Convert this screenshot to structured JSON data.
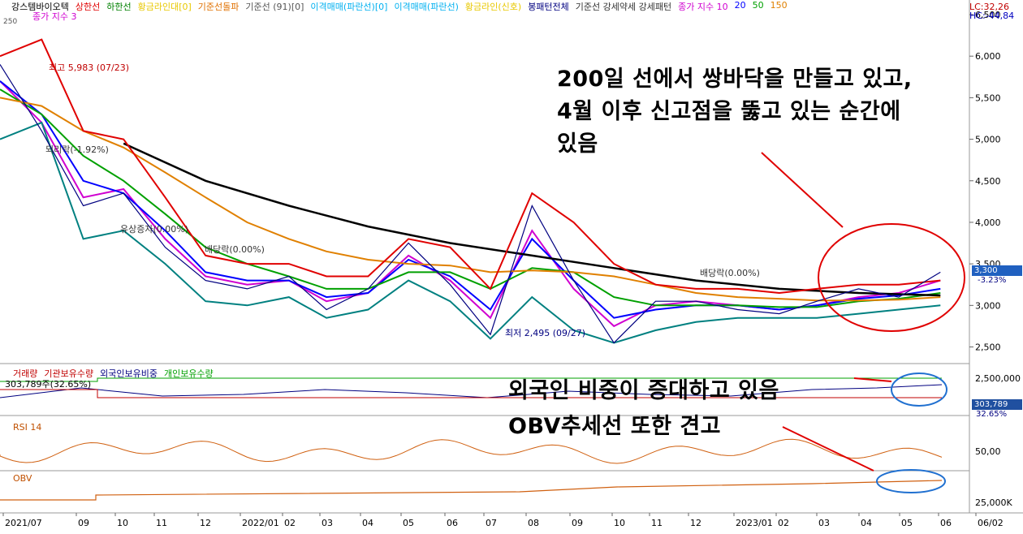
{
  "header": {
    "stock": "강스템바이오텍",
    "indicators": [
      {
        "label": "상한선",
        "color": "#e00000"
      },
      {
        "label": "하한선",
        "color": "#008000"
      },
      {
        "label": "황금라인대[0]",
        "color": "#e8c800"
      },
      {
        "label": "기준선돌파",
        "color": "#e07000"
      },
      {
        "label": "기준선 (91)[0]",
        "color": "#555555"
      },
      {
        "label": "이격매매(파란선)[0]",
        "color": "#00b0f0"
      },
      {
        "label": "이격매매(파란선)",
        "color": "#00b0f0"
      },
      {
        "label": "황금라인(신호)",
        "color": "#e8c800"
      },
      {
        "label": "봉패턴전체",
        "color": "#000080"
      },
      {
        "label": "기준선 강세약세 강세패턴",
        "color": "#333333"
      },
      {
        "label": "종가 지수 10",
        "color": "#d000d0"
      },
      {
        "label": "20",
        "color": "#0000ff"
      },
      {
        "label": "50",
        "color": "#00a000"
      },
      {
        "label": "150",
        "color": "#e08000"
      }
    ],
    "sub_label": "종가 지수 3",
    "small_left": "250",
    "lc": "LC:32,26",
    "hc": "HC:-44,84"
  },
  "price_panel": {
    "y_ticks": [
      "6,500",
      "6,000",
      "5,500",
      "5,000",
      "4,500",
      "4,000",
      "3,500",
      "3,000",
      "2,500"
    ],
    "last_price": "3,300",
    "last_change": "-3.23%",
    "max_label": "최고 5,983 (07/23)",
    "min_label": "최저 2,495 (09/27)",
    "pattern_labels": [
      "되리락(-1.92%)",
      "유상증자(0.00%)",
      "배당락(0.00%)",
      "배당락(0.00%)"
    ]
  },
  "volume_panel": {
    "legend": [
      {
        "label": "거래량",
        "color": "#c00000"
      },
      {
        "label": "기관보유수량",
        "color": "#c00000"
      },
      {
        "label": "외국인보유비중",
        "color": "#000080"
      },
      {
        "label": "개인보유수량",
        "color": "#00a000"
      }
    ],
    "value_label": "303,789주(32.65%)",
    "y_tick": "2,500,000",
    "tag_value": "303,789",
    "tag_pct": "32.65%"
  },
  "rsi_panel": {
    "label": "RSI 14",
    "y_tick": "50,00"
  },
  "obv_panel": {
    "label": "OBV",
    "y_tick": "25,000K"
  },
  "x_labels": [
    "2021/07",
    "09",
    "10",
    "11",
    "12",
    "2022/01",
    "02",
    "03",
    "04",
    "05",
    "06",
    "07",
    "08",
    "09",
    "10",
    "11",
    "12",
    "2023/01",
    "02",
    "03",
    "04",
    "05",
    "06",
    "06/02"
  ],
  "annotations": {
    "main": [
      "200일 선에서 쌍바닥을 만들고 있고,",
      "4월 이후 신고점을 뚫고 있는 순간에",
      "있음"
    ],
    "foreign": "외국인 비중이 증대하고 있음",
    "obv": "OBV추세선 또한 견고"
  },
  "chart_data": {
    "type": "line",
    "title": "강스템바이오텍",
    "x_range": [
      "2021/07",
      "2023/06/02"
    ],
    "ylim": [
      2300,
      6500
    ],
    "series": [
      {
        "name": "종가 지수 10",
        "color": "#d000d0",
        "points": [
          [
            "2021/07",
            5700
          ],
          [
            "2021/08",
            5200
          ],
          [
            "2021/09",
            4300
          ],
          [
            "2021/10",
            4400
          ],
          [
            "2021/11",
            3800
          ],
          [
            "2021/12",
            3350
          ],
          [
            "2022/01",
            3250
          ],
          [
            "2022/02",
            3300
          ],
          [
            "2022/03",
            3050
          ],
          [
            "2022/04",
            3150
          ],
          [
            "2022/05",
            3600
          ],
          [
            "2022/06",
            3300
          ],
          [
            "2022/07",
            2850
          ],
          [
            "2022/08",
            3900
          ],
          [
            "2022/09",
            3200
          ],
          [
            "2022/10",
            2750
          ],
          [
            "2022/11",
            3000
          ],
          [
            "2022/12",
            3050
          ],
          [
            "2023/01",
            3000
          ],
          [
            "2023/02",
            2950
          ],
          [
            "2023/03",
            3000
          ],
          [
            "2023/04",
            3100
          ],
          [
            "2023/05",
            3150
          ],
          [
            "2023/06",
            3300
          ]
        ]
      },
      {
        "name": "20",
        "color": "#0000ff",
        "points": [
          [
            "2021/07",
            5700
          ],
          [
            "2021/08",
            5300
          ],
          [
            "2021/09",
            4500
          ],
          [
            "2021/10",
            4350
          ],
          [
            "2021/11",
            3900
          ],
          [
            "2021/12",
            3400
          ],
          [
            "2022/01",
            3300
          ],
          [
            "2022/02",
            3300
          ],
          [
            "2022/03",
            3100
          ],
          [
            "2022/04",
            3150
          ],
          [
            "2022/05",
            3550
          ],
          [
            "2022/06",
            3350
          ],
          [
            "2022/07",
            2950
          ],
          [
            "2022/08",
            3800
          ],
          [
            "2022/09",
            3300
          ],
          [
            "2022/10",
            2850
          ],
          [
            "2022/11",
            2950
          ],
          [
            "2022/12",
            3000
          ],
          [
            "2023/01",
            3000
          ],
          [
            "2023/02",
            2950
          ],
          [
            "2023/03",
            3000
          ],
          [
            "2023/04",
            3080
          ],
          [
            "2023/05",
            3120
          ],
          [
            "2023/06",
            3200
          ]
        ]
      },
      {
        "name": "50",
        "color": "#00a000",
        "points": [
          [
            "2021/07",
            5600
          ],
          [
            "2021/08",
            5300
          ],
          [
            "2021/09",
            4800
          ],
          [
            "2021/10",
            4500
          ],
          [
            "2021/11",
            4100
          ],
          [
            "2021/12",
            3700
          ],
          [
            "2022/01",
            3500
          ],
          [
            "2022/02",
            3350
          ],
          [
            "2022/03",
            3200
          ],
          [
            "2022/04",
            3200
          ],
          [
            "2022/05",
            3400
          ],
          [
            "2022/06",
            3400
          ],
          [
            "2022/07",
            3200
          ],
          [
            "2022/08",
            3450
          ],
          [
            "2022/09",
            3400
          ],
          [
            "2022/10",
            3100
          ],
          [
            "2022/11",
            3000
          ],
          [
            "2022/12",
            3000
          ],
          [
            "2023/01",
            3000
          ],
          [
            "2023/02",
            2980
          ],
          [
            "2023/03",
            2980
          ],
          [
            "2023/04",
            3050
          ],
          [
            "2023/05",
            3080
          ],
          [
            "2023/06",
            3150
          ]
        ]
      },
      {
        "name": "150",
        "color": "#e08000",
        "points": [
          [
            "2021/07",
            5500
          ],
          [
            "2021/08",
            5400
          ],
          [
            "2021/09",
            5100
          ],
          [
            "2021/10",
            4900
          ],
          [
            "2021/11",
            4600
          ],
          [
            "2021/12",
            4300
          ],
          [
            "2022/01",
            4000
          ],
          [
            "2022/02",
            3800
          ],
          [
            "2022/03",
            3650
          ],
          [
            "2022/04",
            3550
          ],
          [
            "2022/05",
            3500
          ],
          [
            "2022/06",
            3480
          ],
          [
            "2022/07",
            3400
          ],
          [
            "2022/08",
            3420
          ],
          [
            "2022/09",
            3400
          ],
          [
            "2022/10",
            3350
          ],
          [
            "2022/11",
            3250
          ],
          [
            "2022/12",
            3150
          ],
          [
            "2023/01",
            3100
          ],
          [
            "2023/02",
            3080
          ],
          [
            "2023/03",
            3060
          ],
          [
            "2023/04",
            3060
          ],
          [
            "2023/05",
            3070
          ],
          [
            "2023/06",
            3100
          ]
        ]
      },
      {
        "name": "",
        "color": "#000000",
        "points": [
          [
            "2021/10",
            4950
          ],
          [
            "2021/12",
            4500
          ],
          [
            "2022/02",
            4200
          ],
          [
            "2022/04",
            3950
          ],
          [
            "2022/06",
            3750
          ],
          [
            "2022/08",
            3600
          ],
          [
            "2022/10",
            3450
          ],
          [
            "2022/12",
            3300
          ],
          [
            "2023/02",
            3200
          ],
          [
            "2023/04",
            3150
          ],
          [
            "2023/06",
            3120
          ]
        ]
      },
      {
        "name": "상한선",
        "color": "#e00000",
        "points": [
          [
            "2021/07",
            6000
          ],
          [
            "2021/08",
            6200
          ],
          [
            "2021/09",
            5100
          ],
          [
            "2021/10",
            5000
          ],
          [
            "2021/11",
            4300
          ],
          [
            "2021/12",
            3600
          ],
          [
            "2022/01",
            3500
          ],
          [
            "2022/02",
            3500
          ],
          [
            "2022/03",
            3350
          ],
          [
            "2022/04",
            3350
          ],
          [
            "2022/05",
            3800
          ],
          [
            "2022/06",
            3700
          ],
          [
            "2022/07",
            3200
          ],
          [
            "2022/08",
            4350
          ],
          [
            "2022/09",
            4000
          ],
          [
            "2022/10",
            3500
          ],
          [
            "2022/11",
            3250
          ],
          [
            "2022/12",
            3200
          ],
          [
            "2023/01",
            3200
          ],
          [
            "2023/02",
            3150
          ],
          [
            "2023/03",
            3200
          ],
          [
            "2023/04",
            3250
          ],
          [
            "2023/05",
            3250
          ],
          [
            "2023/06",
            3300
          ]
        ]
      },
      {
        "name": "하한선",
        "color": "#008080",
        "points": [
          [
            "2021/07",
            5000
          ],
          [
            "2021/08",
            5200
          ],
          [
            "2021/09",
            3800
          ],
          [
            "2021/10",
            3900
          ],
          [
            "2021/11",
            3500
          ],
          [
            "2021/12",
            3050
          ],
          [
            "2022/01",
            3000
          ],
          [
            "2022/02",
            3100
          ],
          [
            "2022/03",
            2850
          ],
          [
            "2022/04",
            2950
          ],
          [
            "2022/05",
            3300
          ],
          [
            "2022/06",
            3050
          ],
          [
            "2022/07",
            2600
          ],
          [
            "2022/08",
            3100
          ],
          [
            "2022/09",
            2700
          ],
          [
            "2022/10",
            2550
          ],
          [
            "2022/11",
            2700
          ],
          [
            "2022/12",
            2800
          ],
          [
            "2023/01",
            2850
          ],
          [
            "2023/02",
            2850
          ],
          [
            "2023/03",
            2850
          ],
          [
            "2023/04",
            2900
          ],
          [
            "2023/05",
            2950
          ],
          [
            "2023/06",
            3000
          ]
        ]
      }
    ],
    "price_line": {
      "color": "#000080",
      "points": [
        [
          "2021/07",
          5900
        ],
        [
          "2021/08",
          5100
        ],
        [
          "2021/09",
          4200
        ],
        [
          "2021/10",
          4350
        ],
        [
          "2021/11",
          3700
        ],
        [
          "2021/12",
          3300
        ],
        [
          "2022/01",
          3200
        ],
        [
          "2022/02",
          3350
        ],
        [
          "2022/03",
          2950
        ],
        [
          "2022/04",
          3200
        ],
        [
          "2022/05",
          3750
        ],
        [
          "2022/06",
          3250
        ],
        [
          "2022/07",
          2650
        ],
        [
          "2022/08",
          4200
        ],
        [
          "2022/09",
          3300
        ],
        [
          "2022/10",
          2550
        ],
        [
          "2022/11",
          3050
        ],
        [
          "2022/12",
          3050
        ],
        [
          "2023/01",
          2950
        ],
        [
          "2023/02",
          2900
        ],
        [
          "2023/03",
          3050
        ],
        [
          "2023/04",
          3200
        ],
        [
          "2023/05",
          3100
        ],
        [
          "2023/06",
          3400
        ]
      ]
    }
  }
}
